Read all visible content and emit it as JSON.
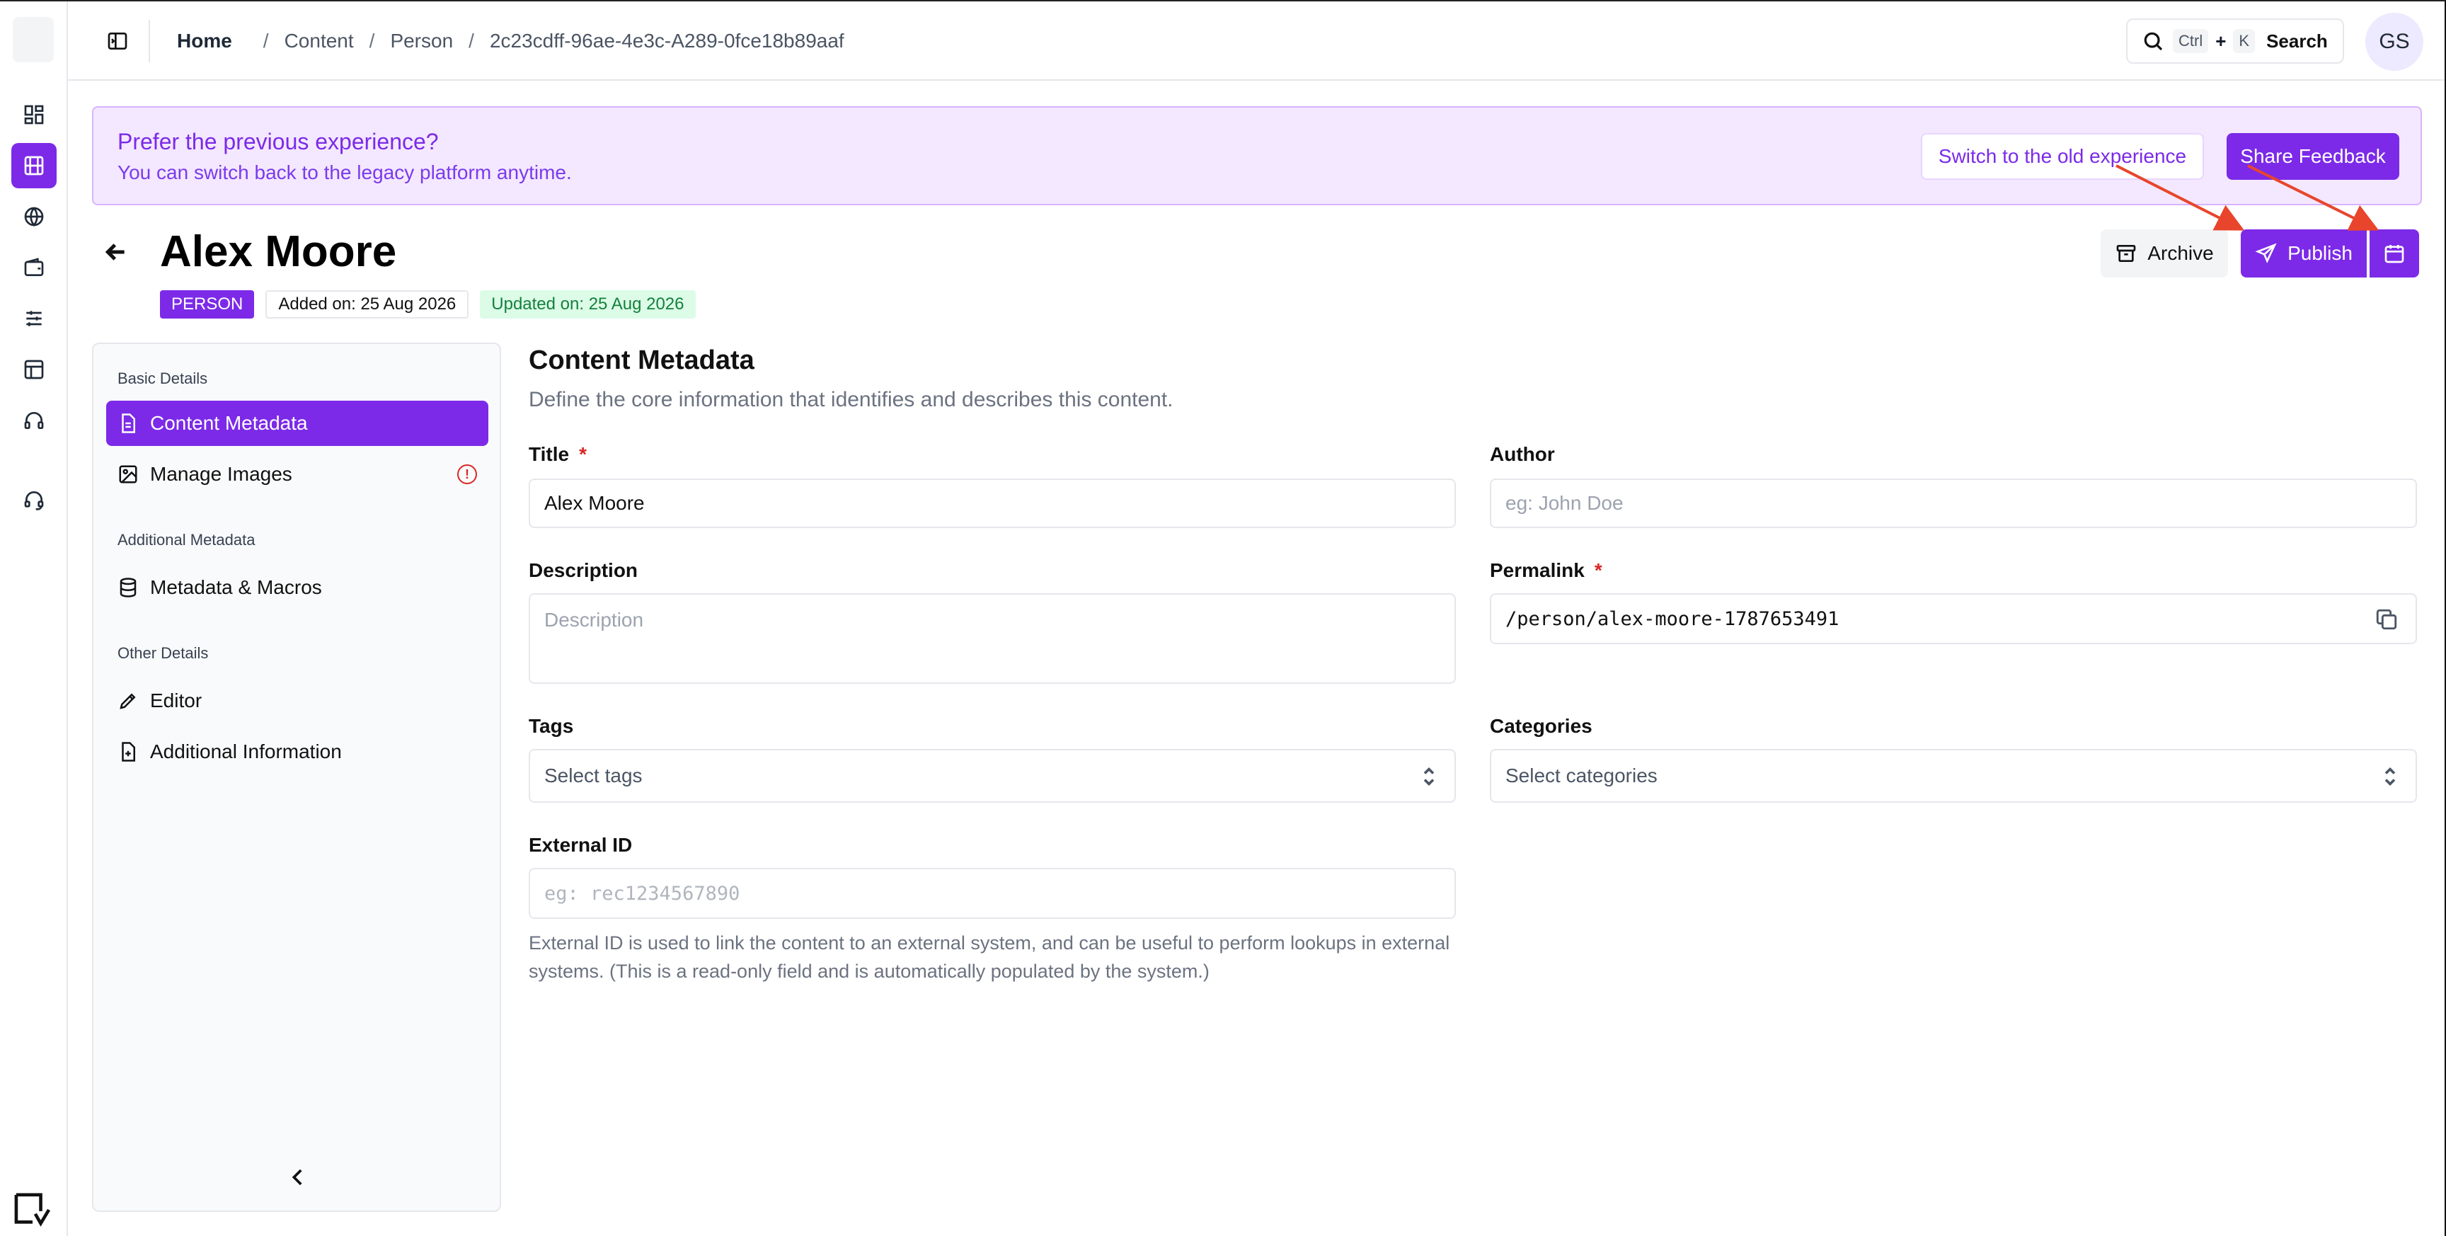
{
  "breadcrumb": {
    "home": "Home",
    "items": [
      "Content",
      "Person",
      "2c23cdff-96ae-4e3c-A289-0fce18b89aaf"
    ]
  },
  "search": {
    "key1": "Ctrl",
    "plus": "+",
    "key2": "K",
    "label": "Search"
  },
  "user": {
    "initials": "GS"
  },
  "banner": {
    "title": "Prefer the previous experience?",
    "text": "You can switch back to the legacy platform anytime.",
    "switch_label": "Switch to the old experience",
    "feedback_label": "Share Feedback"
  },
  "record": {
    "title": "Alex Moore",
    "type_badge": "PERSON",
    "added": "Added on: 25 Aug 2026",
    "updated": "Updated on: 25 Aug 2026"
  },
  "actions": {
    "archive_label": "Archive",
    "publish_label": "Publish"
  },
  "sidebar": {
    "sections": [
      {
        "title": "Basic Details",
        "items": [
          {
            "label": "Content Metadata",
            "icon": "document-icon",
            "active": true
          },
          {
            "label": "Manage Images",
            "icon": "image-icon",
            "warning": "!"
          }
        ]
      },
      {
        "title": "Additional Metadata",
        "items": [
          {
            "label": "Metadata & Macros",
            "icon": "database-icon"
          }
        ]
      },
      {
        "title": "Other Details",
        "items": [
          {
            "label": "Editor",
            "icon": "pencil-icon"
          },
          {
            "label": "Additional Information",
            "icon": "file-plus-icon"
          }
        ]
      }
    ]
  },
  "form": {
    "heading": "Content Metadata",
    "subheading": "Define the core information that identifies and describes this content.",
    "title": {
      "label": "Title",
      "required": "*",
      "value": "Alex Moore"
    },
    "author": {
      "label": "Author",
      "placeholder": "eg: John Doe"
    },
    "description": {
      "label": "Description",
      "placeholder": "Description"
    },
    "permalink": {
      "label": "Permalink",
      "required": "*",
      "value": "/person/alex-moore-1787653491"
    },
    "tags": {
      "label": "Tags",
      "placeholder": "Select tags"
    },
    "categories": {
      "label": "Categories",
      "placeholder": "Select categories"
    },
    "external_id": {
      "label": "External ID",
      "placeholder": "eg: rec1234567890",
      "help": "External ID is used to link the content to an external system, and can be useful to perform lookups in external systems. (This is a read-only field and is automatically populated by the system.)"
    }
  },
  "colors": {
    "accent": "#7c2ae8",
    "banner_bg": "#f3e8ff",
    "updated_badge_bg": "#dcfce7",
    "required": "#dc2626",
    "annotation_arrow": "#e8452c"
  }
}
